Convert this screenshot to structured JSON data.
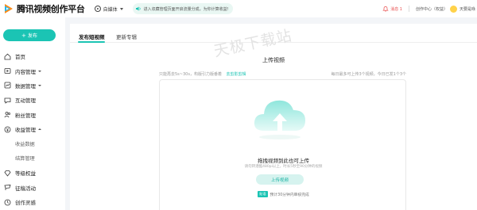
{
  "header": {
    "brand": "腾讯视频创作平台",
    "mode_label": "自媒体",
    "notice": "进入収藏管理页面开启流量分成，为你计算收益!",
    "messages": "消息 1",
    "creator_center": "创作中心（权益）",
    "username": "天要是咏",
    "brand_color": "#1bc4b4"
  },
  "sidebar": {
    "publish_label": "发布",
    "items": [
      {
        "label": "首页",
        "icon": "home-icon"
      },
      {
        "label": "内容管理",
        "icon": "content-icon"
      },
      {
        "label": "数据管理",
        "icon": "data-icon"
      },
      {
        "label": "互动管理",
        "icon": "interaction-icon"
      },
      {
        "label": "粉丝管理",
        "icon": "fans-icon"
      },
      {
        "label": "收益管理",
        "icon": "revenue-icon"
      },
      {
        "label": "收益数据"
      },
      {
        "label": "结算管理"
      },
      {
        "label": "等级权益",
        "icon": "level-icon"
      },
      {
        "label": "征稿活动",
        "icon": "activity-icon"
      },
      {
        "label": "创作灵感",
        "icon": "inspiration-icon"
      }
    ]
  },
  "main": {
    "tabs": [
      {
        "label": "发布短视频"
      },
      {
        "label": "更新专辑"
      }
    ],
    "watermark": "天极下载站",
    "upload_title": "上传视频",
    "hint_left": "只能再去5s~30s，构版引力版番着",
    "hint_link": "去剪影剪辑",
    "hint_right": "每日最多可上传3个视频，今日已发1个3个",
    "drop_text": "拖拽视频到此也可上传",
    "drop_sub": "请勿转潜酷480pi以上，时长5秒至90分钟的视频",
    "upload_button": "上传视频",
    "tip_badge": "贴语",
    "tip_text": "预计30分钟内审核完成"
  }
}
